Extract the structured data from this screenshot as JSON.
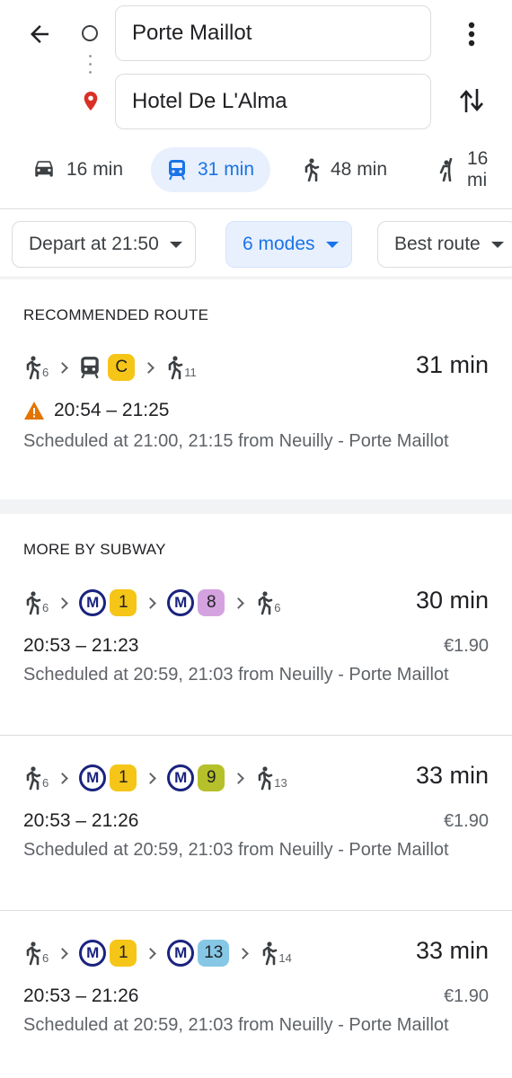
{
  "search": {
    "from": "Porte Maillot",
    "to": "Hotel De L'Alma"
  },
  "modes": [
    {
      "icon": "car-icon",
      "label": "16 min"
    },
    {
      "icon": "transit-icon",
      "label": "31 min",
      "active": true
    },
    {
      "icon": "walking-icon",
      "label": "48 min"
    },
    {
      "icon": "ride-hailing-icon",
      "label": "16 mi"
    }
  ],
  "filters": {
    "depart": "Depart at 21:50",
    "modes": "6 modes",
    "route": "Best route"
  },
  "recommended": {
    "title": "RECOMMENDED ROUTE",
    "walk_start": "6",
    "line": "C",
    "walk_end": "11",
    "duration": "31 min",
    "times": "20:54 – 21:25",
    "schedule": "Scheduled at 21:00, 21:15 from Neuilly - Porte Maillot"
  },
  "subway": {
    "title": "MORE BY SUBWAY",
    "routes": [
      {
        "walk_start": "6",
        "line1": "1",
        "line2": "8",
        "walk_end": "6",
        "duration": "30 min",
        "times": "20:53 – 21:23",
        "price": "€1.90",
        "schedule": "Scheduled at 20:59, 21:03 from Neuilly - Porte Maillot"
      },
      {
        "walk_start": "6",
        "line1": "1",
        "line2": "9",
        "walk_end": "13",
        "duration": "33 min",
        "times": "20:53 – 21:26",
        "price": "€1.90",
        "schedule": "Scheduled at 20:59, 21:03 from Neuilly - Porte Maillot"
      },
      {
        "walk_start": "6",
        "line1": "1",
        "line2": "13",
        "walk_end": "14",
        "duration": "33 min",
        "times": "20:53 – 21:26",
        "price": "€1.90",
        "schedule": "Scheduled at 20:59, 21:03 from Neuilly - Porte Maillot"
      }
    ]
  },
  "metro_label": "M",
  "colors": {
    "accent": "#1a73e8",
    "rer_c": "#f5c518",
    "metro_1": "#f5c518",
    "metro_8": "#d5a2e0",
    "metro_9": "#b5c02a",
    "metro_13": "#86c7e6",
    "warning": "#e37400"
  }
}
